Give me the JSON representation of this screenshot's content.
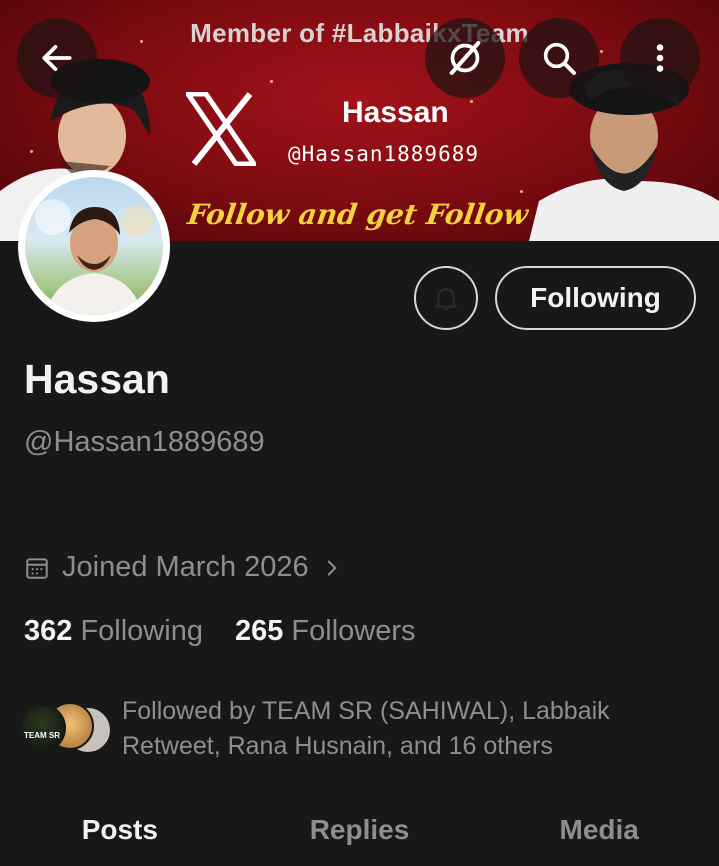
{
  "banner": {
    "top_text": "Member of #LabbaikxTeam",
    "name": "Hassan",
    "handle": "@Hassan1889689",
    "tagline": "Follow and get Follow Back"
  },
  "toolbar": {
    "back_icon": "arrow-left-icon",
    "grok_icon": "grok-icon",
    "search_icon": "search-icon",
    "more_icon": "more-vertical-icon"
  },
  "profile": {
    "following_button": "Following",
    "display_name": "Hassan",
    "handle": "@Hassan1889689",
    "joined": "Joined March 2026",
    "following_count": "362",
    "following_label": "Following",
    "followers_count": "265",
    "followers_label": "Followers",
    "followed_by_line1": "Followed by TEAM SR (SAHIWAL), Labbaik",
    "followed_by_line2": "Retweet, Rana Husnain, and 16 others",
    "mini_avatar_text": "TEAM SR"
  },
  "tabs": [
    {
      "label": "Posts",
      "active": true
    },
    {
      "label": "Replies",
      "active": false
    },
    {
      "label": "Media",
      "active": false
    }
  ],
  "colors": {
    "background": "#181818",
    "banner_red": "#a3121a",
    "muted_text": "#8b8f93",
    "tagline_yellow": "#f4d23d"
  }
}
